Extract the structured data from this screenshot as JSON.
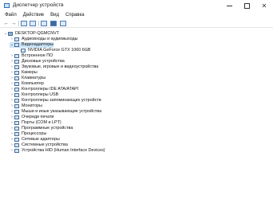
{
  "window": {
    "title": "Диспетчер устройств",
    "controls": {
      "minimize": "—",
      "maximize": "□",
      "close": "✕"
    }
  },
  "menu": [
    "Файл",
    "Действие",
    "Вид",
    "Справка"
  ],
  "toolbar": {
    "back_icon": "arrow-left",
    "forward_icon": "arrow-right"
  },
  "tree": {
    "root": "DESKTOP-QGMCNVT",
    "items": [
      {
        "label": "Аудиовходы и аудиовыходы",
        "expanded": false
      },
      {
        "label": "Видеоадаптеры",
        "expanded": true,
        "selected": true,
        "children": [
          "NVIDIA GeForce GTX 1060 6GB"
        ]
      },
      {
        "label": "Встроенное ПО",
        "expanded": false
      },
      {
        "label": "Дисковые устройства",
        "expanded": false
      },
      {
        "label": "Звуковые, игровые и видеоустройства",
        "expanded": false
      },
      {
        "label": "Камеры",
        "expanded": false
      },
      {
        "label": "Клавиатуры",
        "expanded": false
      },
      {
        "label": "Компьютер",
        "expanded": false
      },
      {
        "label": "Контроллеры IDE ATA/ATAPI",
        "expanded": false
      },
      {
        "label": "Контроллеры USB",
        "expanded": false
      },
      {
        "label": "Контроллеры запоминающих устройств",
        "expanded": false
      },
      {
        "label": "Мониторы",
        "expanded": false
      },
      {
        "label": "Мыши и иные указывающие устройства",
        "expanded": false
      },
      {
        "label": "Очереди печати",
        "expanded": false
      },
      {
        "label": "Порты (COM и LPT)",
        "expanded": false
      },
      {
        "label": "Программные устройства",
        "expanded": false
      },
      {
        "label": "Процессоры",
        "expanded": false
      },
      {
        "label": "Сетевые адаптеры",
        "expanded": false
      },
      {
        "label": "Системные устройства",
        "expanded": false
      },
      {
        "label": "Устройства HID (Human Interface Devices)",
        "expanded": false
      }
    ]
  }
}
